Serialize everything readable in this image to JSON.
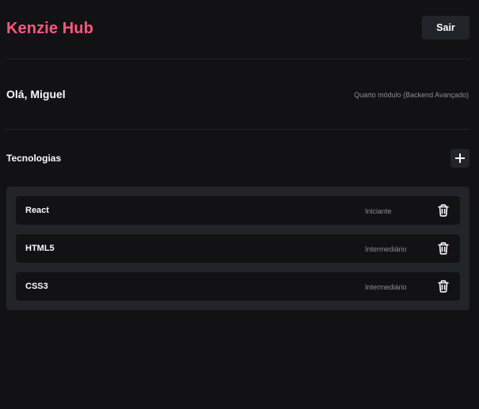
{
  "header": {
    "logo": "Kenzie Hub",
    "logout_label": "Sair"
  },
  "profile": {
    "greeting": "Olá, Miguel",
    "module": "Quarto módulo (Backend Avançado)"
  },
  "technologies": {
    "title": "Tecnologias",
    "add_icon": "plus-icon",
    "items": [
      {
        "name": "React",
        "status": "Iniciante",
        "icon": "trash-icon"
      },
      {
        "name": "HTML5",
        "status": "Intermediário",
        "icon": "trash-icon"
      },
      {
        "name": "CSS3",
        "status": "Intermediário",
        "icon": "trash-icon"
      }
    ]
  },
  "colors": {
    "background": "#121214",
    "surface": "#212529",
    "brand": "#ff577f",
    "text": "#f8f9fa",
    "muted": "#868e96"
  }
}
